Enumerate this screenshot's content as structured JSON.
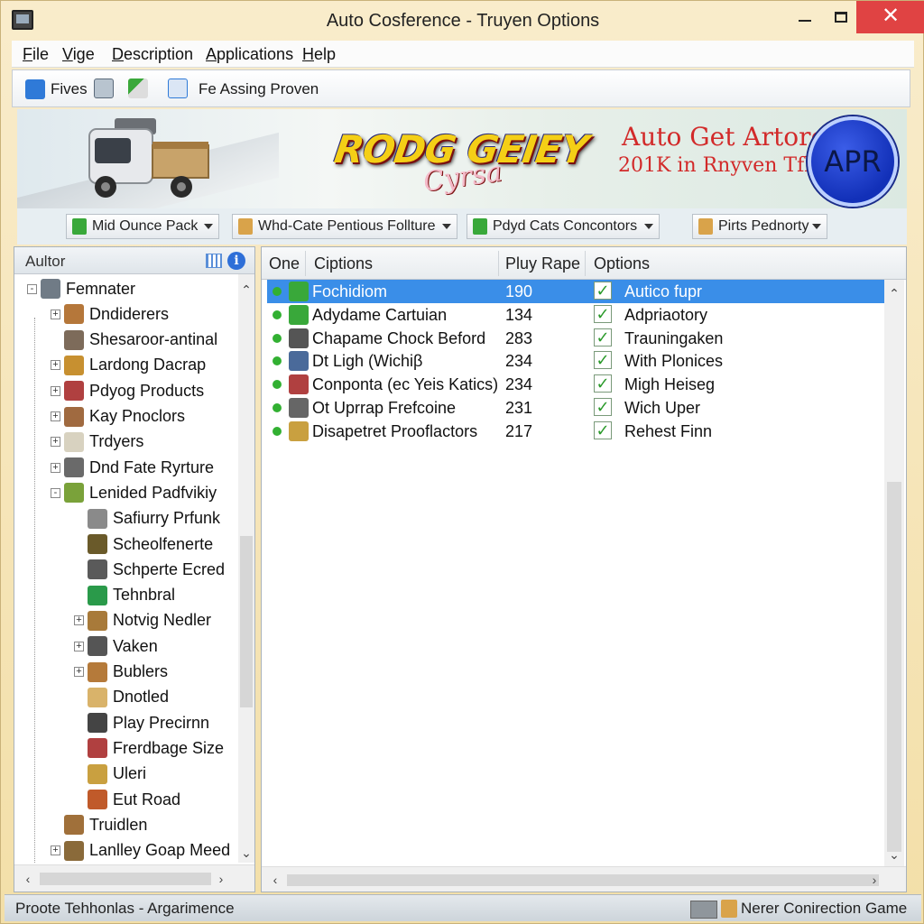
{
  "window": {
    "title": "Auto Cosference - Truyen Options",
    "minimize": "",
    "maximize": "",
    "close": "✕"
  },
  "menu": [
    "File",
    "Vige",
    "Description",
    "Applications",
    "Help"
  ],
  "toolbar": {
    "fives_label": "Fives",
    "assing_label": "Fe Assing Proven"
  },
  "banner": {
    "logo_text": "RODG GEIEY",
    "logo_sub": "Cyrsa",
    "title": "Auto Get Artored",
    "subtitle": "201K in Rnyven Tfk",
    "badge": "APR"
  },
  "dropdowns": [
    {
      "label": "Mid Ounce Pack",
      "color": "#39a83a"
    },
    {
      "label": "Whd-Cate Pentious Follture",
      "color": "#d9a34a"
    },
    {
      "label": "Pdyd Cats Concontors",
      "color": "#39a83a"
    },
    {
      "label": "Pirts Pednorty",
      "color": "#d9a34a"
    }
  ],
  "left_panel": {
    "title": "Aultor",
    "tree": [
      {
        "label": "Femnater",
        "level": 0,
        "expander": "-",
        "color": "#707b86"
      },
      {
        "label": "Dndiderers",
        "level": 1,
        "expander": "+",
        "color": "#b5773a"
      },
      {
        "label": "Shesaroor-antinal",
        "level": 1,
        "expander": "",
        "color": "#7d6b5a"
      },
      {
        "label": "Lardong Dacrap",
        "level": 1,
        "expander": "+",
        "color": "#c79030"
      },
      {
        "label": "Pdyog Products",
        "level": 1,
        "expander": "+",
        "color": "#b04040"
      },
      {
        "label": "Kay Pnoclors",
        "level": 1,
        "expander": "+",
        "color": "#a06a40"
      },
      {
        "label": "Trdyers",
        "level": 1,
        "expander": "+",
        "color": "#d8d2c0"
      },
      {
        "label": "Dnd Fate Ryrture",
        "level": 1,
        "expander": "+",
        "color": "#6a6a6a"
      },
      {
        "label": "Lenided Padfvikiy",
        "level": 1,
        "expander": "-",
        "color": "#7aa23a"
      },
      {
        "label": "Safiurry Prfunk",
        "level": 2,
        "expander": "",
        "color": "#8a8a8a"
      },
      {
        "label": "Scheolfenerte",
        "level": 2,
        "expander": "",
        "color": "#6a5a2a"
      },
      {
        "label": "Schperte Ecred",
        "level": 2,
        "expander": "",
        "color": "#5a5a5a"
      },
      {
        "label": "Tehnbral",
        "level": 2,
        "expander": "",
        "color": "#2a9a4a"
      },
      {
        "label": "Notvig Nedler",
        "level": 2,
        "expander": "+",
        "color": "#a87a3a"
      },
      {
        "label": "Vaken",
        "level": 2,
        "expander": "+",
        "color": "#555"
      },
      {
        "label": "Bublers",
        "level": 2,
        "expander": "+",
        "color": "#b57a3a"
      },
      {
        "label": "Dnotled",
        "level": 2,
        "expander": "",
        "color": "#d9b36a"
      },
      {
        "label": "Play Precirnn",
        "level": 2,
        "expander": "",
        "color": "#444"
      },
      {
        "label": "Frerdbage Size",
        "level": 2,
        "expander": "",
        "color": "#b04040"
      },
      {
        "label": "Uleri",
        "level": 2,
        "expander": "",
        "color": "#c9a040"
      },
      {
        "label": "Eut Road",
        "level": 2,
        "expander": "",
        "color": "#c05a2a"
      },
      {
        "label": "Truidlen",
        "level": 1,
        "expander": "",
        "color": "#a0703a"
      },
      {
        "label": "Lanlley Goap Meed",
        "level": 1,
        "expander": "+",
        "color": "#8a6a3a"
      }
    ]
  },
  "right_panel": {
    "columns": [
      "One",
      "Ciptions",
      "Pluy Rape",
      "Options"
    ],
    "rows": [
      {
        "name": "Fochidiom",
        "rate": "190",
        "checked": true,
        "option": "Autico fupr",
        "selected": true,
        "color": "#39a83a"
      },
      {
        "name": "Adydame Cartuian",
        "rate": "134",
        "checked": true,
        "option": "Adpriaotory",
        "selected": false,
        "color": "#39a83a"
      },
      {
        "name": "Chapame Chock Beford",
        "rate": "283",
        "checked": true,
        "option": "Trauningaken",
        "selected": false,
        "color": "#555"
      },
      {
        "name": "Dt Ligh (Wichiβ",
        "rate": "234",
        "checked": true,
        "option": "With Plonices",
        "selected": false,
        "color": "#4a6a9a"
      },
      {
        "name": "Conponta (ec Yeis Katics)",
        "rate": "234",
        "checked": true,
        "option": "Migh Heiseg",
        "selected": false,
        "color": "#b04040"
      },
      {
        "name": "Ot Uprrap Frefcoine",
        "rate": "231",
        "checked": true,
        "option": "Wich Uper",
        "selected": false,
        "color": "#666"
      },
      {
        "name": "Disapetret Prooflactors",
        "rate": "217",
        "checked": true,
        "option": "Rehest Finn",
        "selected": false,
        "color": "#c9a040"
      }
    ]
  },
  "status": {
    "left": "Proote Tehhonlas - Argarimence",
    "right": "Nerer Conirection Game"
  },
  "colors": {
    "selection": "#3a8ee8",
    "close_button": "#e04343",
    "banner_title": "#d22a2a"
  }
}
